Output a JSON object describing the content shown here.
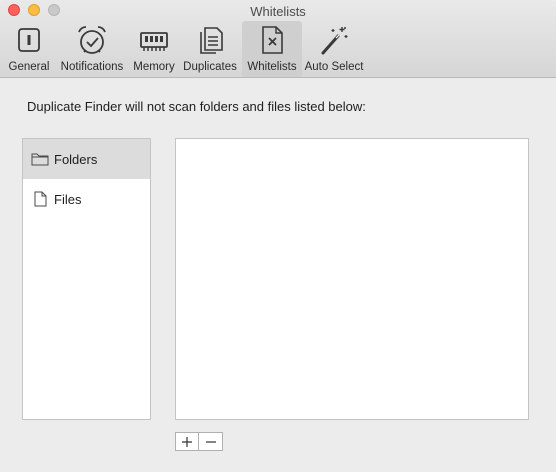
{
  "window": {
    "title": "Whitelists"
  },
  "toolbar": {
    "items": [
      {
        "label": "General",
        "icon": "general-icon"
      },
      {
        "label": "Notifications",
        "icon": "alarm-clock-icon"
      },
      {
        "label": "Memory",
        "icon": "memory-chip-icon"
      },
      {
        "label": "Duplicates",
        "icon": "duplicate-documents-icon"
      },
      {
        "label": "Whitelists",
        "icon": "document-x-icon",
        "selected": true
      },
      {
        "label": "Auto Select",
        "icon": "magic-wand-icon"
      }
    ]
  },
  "main": {
    "description": "Duplicate Finder will not scan folders and files listed below:",
    "sidebar": {
      "items": [
        {
          "label": "Folders",
          "icon": "folder-icon",
          "selected": true
        },
        {
          "label": "Files",
          "icon": "file-icon"
        }
      ]
    },
    "list": {
      "items": []
    },
    "add_label": "+",
    "remove_label": "−"
  },
  "colors": {
    "selected_tab": "#cfcfcf",
    "close": "#fc605c",
    "minimize": "#fdbc40"
  }
}
